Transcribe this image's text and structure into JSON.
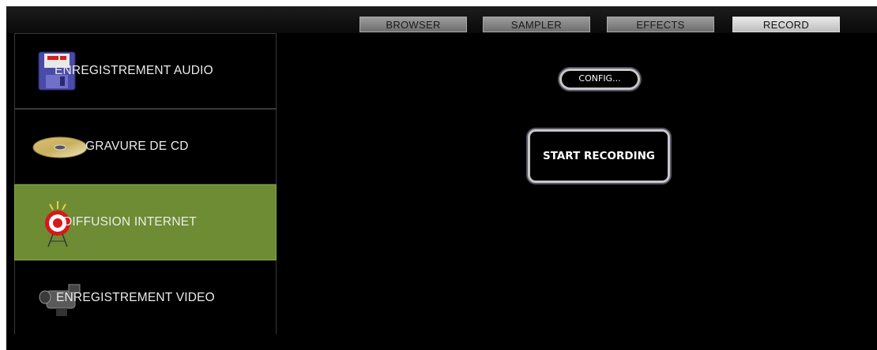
{
  "tabs": [
    {
      "label": "BROWSER",
      "active": false
    },
    {
      "label": "SAMPLER",
      "active": false
    },
    {
      "label": "EFFECTS",
      "active": false
    },
    {
      "label": "RECORD",
      "active": true
    }
  ],
  "sidebar": {
    "items": [
      {
        "label": "ENREGISTREMENT AUDIO",
        "icon": "floppy-disk-icon",
        "active": false
      },
      {
        "label": "GRAVURE DE CD",
        "icon": "cd-disc-icon",
        "active": false
      },
      {
        "label": "DIFFUSION INTERNET",
        "icon": "broadcast-target-icon",
        "active": true
      },
      {
        "label": "ENREGISTREMENT VIDEO",
        "icon": "video-camera-icon",
        "active": false
      }
    ]
  },
  "main": {
    "config_label": "CONFIG...",
    "start_label": "START RECORDING"
  },
  "colors": {
    "active_item": "#6e8c34",
    "background": "#000000",
    "active_tab": "#e0e0e0"
  }
}
